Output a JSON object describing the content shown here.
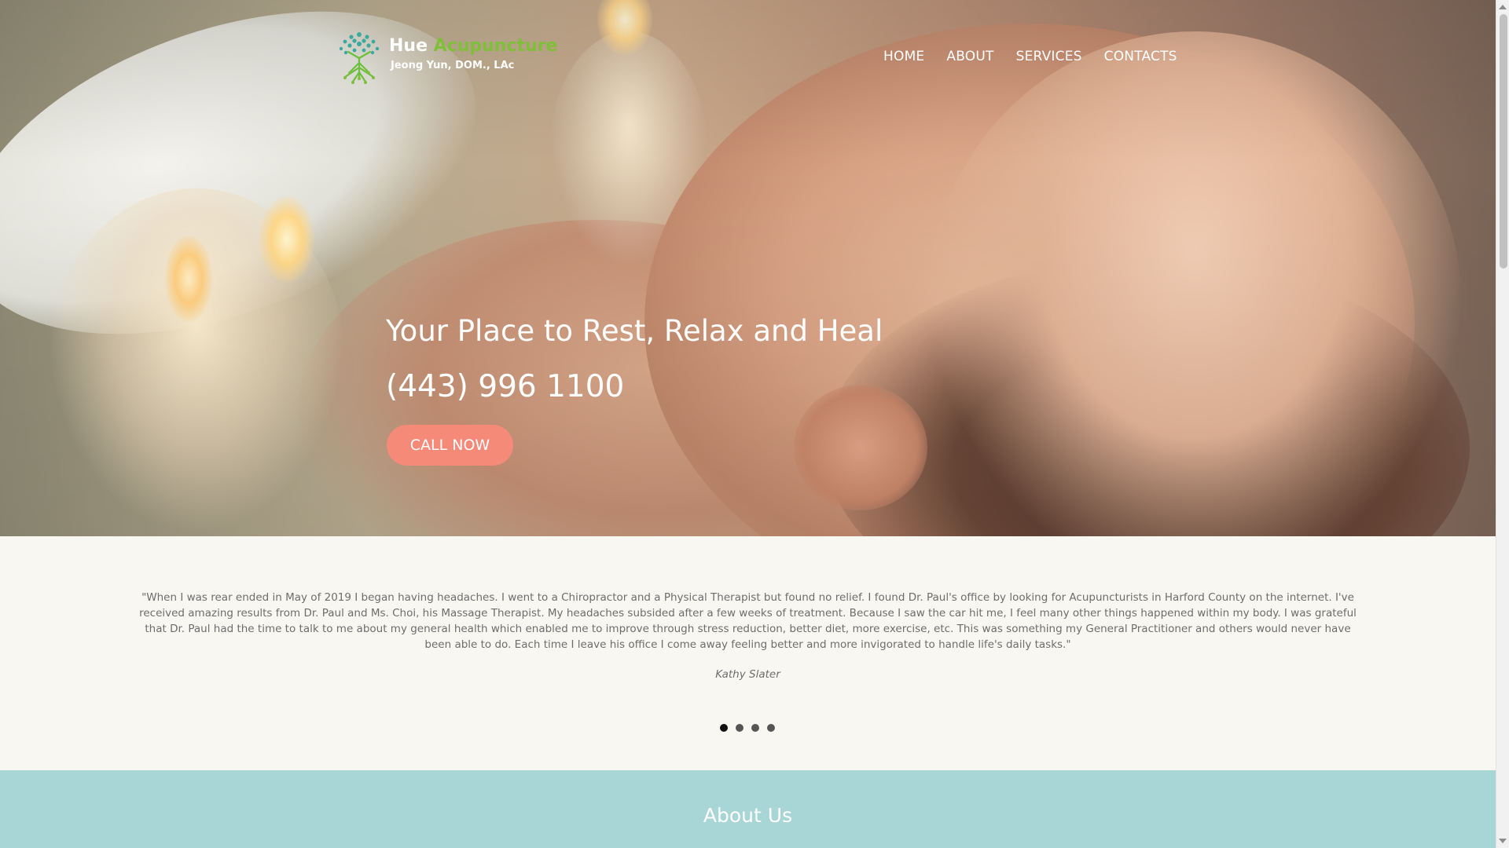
{
  "header": {
    "logo": {
      "title_part1": "Hue",
      "title_part2": "Acupuncture",
      "subtitle": "Jeong Yun, DOM., LAc",
      "icon": "tree-of-life-logo-icon"
    },
    "nav": [
      {
        "label": "HOME"
      },
      {
        "label": "ABOUT"
      },
      {
        "label": "SERVICES"
      },
      {
        "label": "CONTACTS"
      }
    ]
  },
  "hero": {
    "title": "Your Place to Rest, Relax and Heal",
    "phone": "(443) 996 1100",
    "cta_label": "CALL NOW"
  },
  "testimonial": {
    "quote": "\"When I was rear ended in May of 2019 I began having headaches. I went to a Chiropractor and a Physical Therapist but found no relief. I found Dr. Paul's office by looking for Acupuncturists in Harford County on the internet. I've received amazing results from Dr. Paul and Ms. Choi, his Massage Therapist. My headaches subsided after a few weeks of treatment. Because I saw the car hit me, I feel many other things happened within my body. I was grateful that Dr. Paul had the time to talk to me about my general health which enabled me to improve through stress reduction, better diet, more exercise, etc. This was something my General Practitioner and others would never have been able to do. Each time I leave his office I come away feeling better and more invigorated to handle life's daily tasks.\"",
    "author": "Kathy Slater",
    "slide_count": 4,
    "active_slide": 1
  },
  "about": {
    "title": "About Us"
  },
  "colors": {
    "accent_cta": "#f58a78",
    "logo_green": "#7fbf3a",
    "logo_teal": "#3aa9a0",
    "about_bg": "#a8d5d6",
    "testimonial_bg": "#f8f7f2"
  }
}
